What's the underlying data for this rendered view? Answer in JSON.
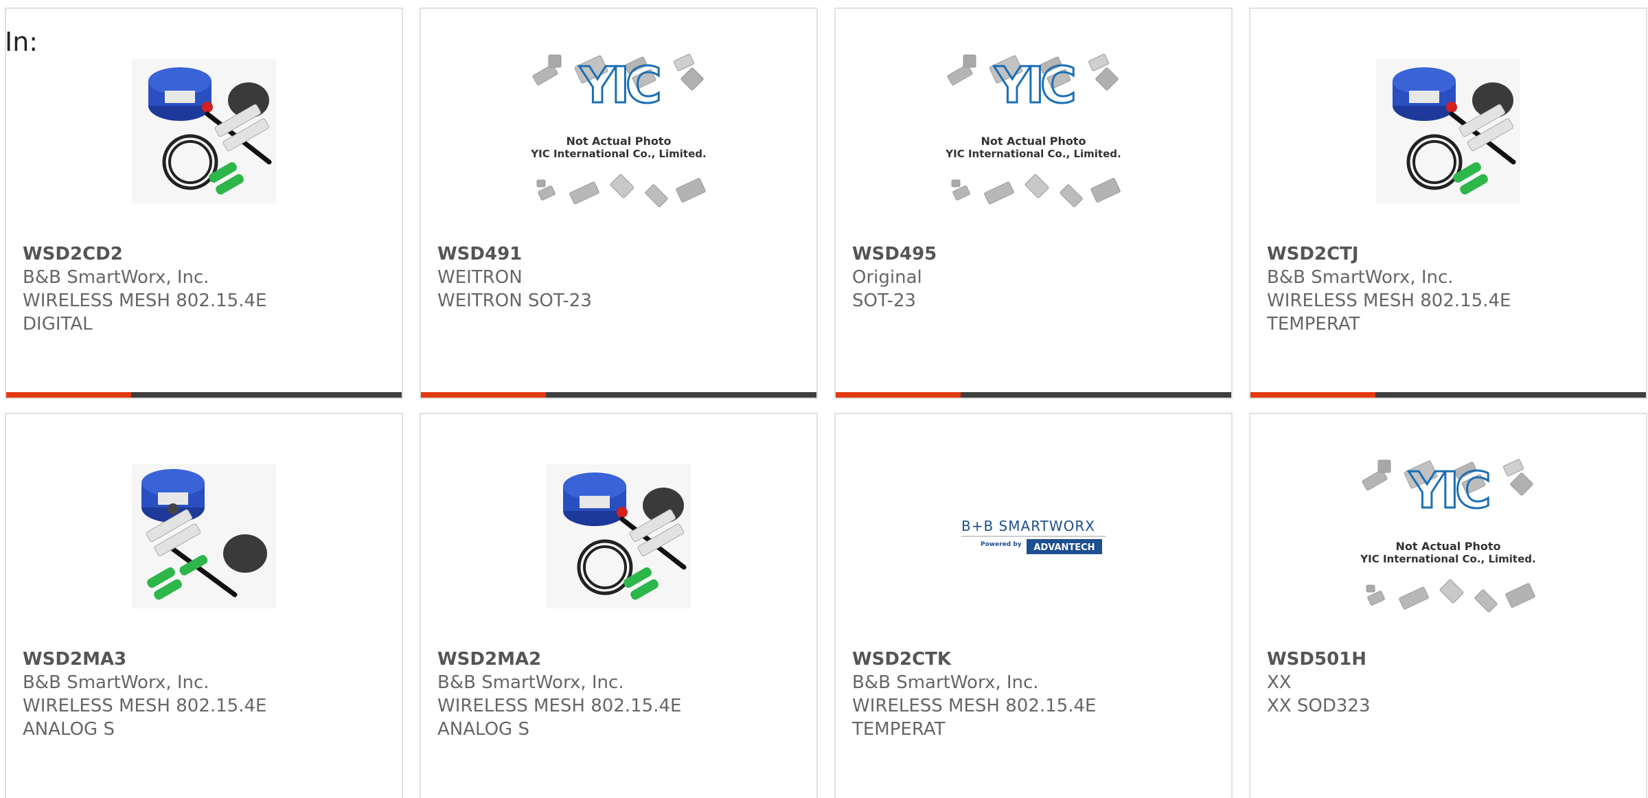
{
  "header": {
    "in_label": "In:"
  },
  "products": [
    {
      "part": "WSD2CD2",
      "maker": "B&B SmartWorx, Inc.",
      "desc1": "WIRELESS MESH 802.15.4E",
      "desc2": "DIGITAL",
      "image": "sensor-kit-photo"
    },
    {
      "part": "WSD491",
      "maker": "WEITRON",
      "desc1": "WEITRON SOT-23",
      "desc2": "",
      "image": "yic-placeholder",
      "placeholder_text1": "Not Actual Photo",
      "placeholder_text2": "YIC International Co., Limited."
    },
    {
      "part": "WSD495",
      "maker": "Original",
      "desc1": "SOT-23",
      "desc2": "",
      "image": "yic-placeholder",
      "placeholder_text1": "Not Actual Photo",
      "placeholder_text2": "YIC International Co., Limited."
    },
    {
      "part": "WSD2CTJ",
      "maker": "B&B SmartWorx, Inc.",
      "desc1": "WIRELESS MESH 802.15.4E",
      "desc2": "TEMPERAT",
      "image": "sensor-kit-photo"
    },
    {
      "part": "WSD2MA3",
      "maker": "B&B SmartWorx, Inc.",
      "desc1": "WIRELESS MESH 802.15.4E",
      "desc2": "ANALOG S",
      "image": "sensor-kit-photo-b"
    },
    {
      "part": "WSD2MA2",
      "maker": "B&B SmartWorx, Inc.",
      "desc1": "WIRELESS MESH 802.15.4E",
      "desc2": "ANALOG S",
      "image": "sensor-kit-photo"
    },
    {
      "part": "WSD2CTK",
      "maker": "B&B SmartWorx, Inc.",
      "desc1": "WIRELESS MESH 802.15.4E",
      "desc2": "TEMPERAT",
      "image": "bb-smartworx-logo",
      "logo_text1": "B+B SMARTWORX",
      "logo_text2": "Powered by",
      "logo_text3": "ADVANTECH"
    },
    {
      "part": "WSD501H",
      "maker": "XX",
      "desc1": "XX SOD323",
      "desc2": "",
      "image": "yic-placeholder",
      "placeholder_text1": "Not Actual Photo",
      "placeholder_text2": "YIC International Co., Limited."
    }
  ],
  "colors": {
    "accent": "#e23a12",
    "bar": "#3f3f3f",
    "border": "#e1e1e1",
    "text": "#666666",
    "yic_blue": "#1b6fb3",
    "chip_gray": "#b5b5b5",
    "sensor_blue": "#2a4fc0",
    "advantech_blue": "#1e4f8f"
  }
}
